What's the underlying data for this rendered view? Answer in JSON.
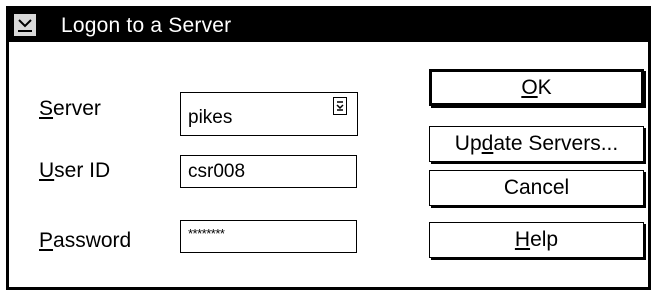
{
  "window": {
    "title": "Logon to a Server",
    "system_menu_icon": "system-menu-icon"
  },
  "fields": {
    "server": {
      "label_mnemonic": "S",
      "label_rest": "erver",
      "value": "pikes",
      "dropdown_icon": "dropdown-arrow-icon"
    },
    "user_id": {
      "label_mnemonic": "U",
      "label_rest": "ser ID",
      "value": "csr008"
    },
    "password": {
      "label_mnemonic": "P",
      "label_rest": "assword",
      "value": "********"
    }
  },
  "buttons": {
    "ok": {
      "mnemonic": "O",
      "rest": "K"
    },
    "update_servers": {
      "before": "Up",
      "mnemonic": "d",
      "after": "ate Servers..."
    },
    "cancel": {
      "label": "Cancel"
    },
    "help": {
      "mnemonic": "H",
      "rest": "elp"
    }
  }
}
